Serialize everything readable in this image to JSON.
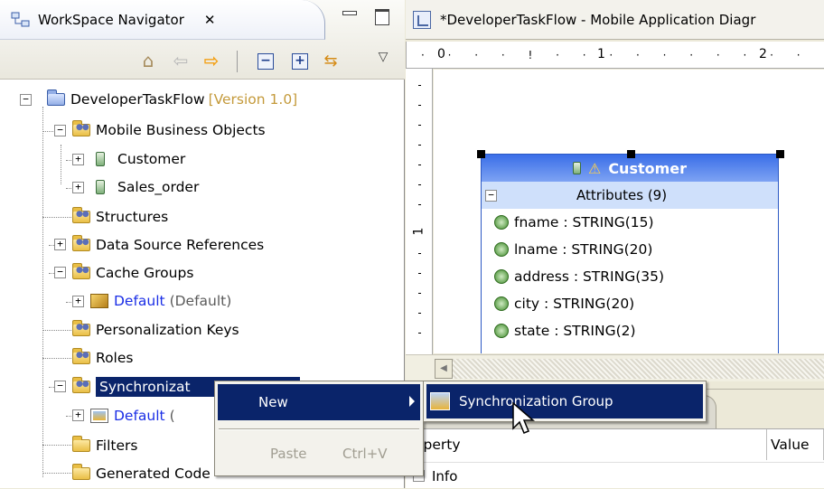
{
  "navigator": {
    "tab_title": "WorkSpace Navigator",
    "close_glyph": "✕"
  },
  "toolbar": {
    "icons": [
      "home-icon",
      "back-arrow-icon",
      "forward-arrow-icon",
      "collapse-all-icon",
      "expand-all-icon",
      "link-with-editor-icon",
      "view-menu-icon"
    ],
    "collapse_glyph": "−",
    "expand_glyph": "+"
  },
  "tree": {
    "project": {
      "label": "DeveloperTaskFlow",
      "version": "[Version 1.0]"
    },
    "items": [
      {
        "label": "Mobile Business Objects"
      },
      {
        "label": "Customer"
      },
      {
        "label": "Sales_order"
      },
      {
        "label": "Structures"
      },
      {
        "label": "Data Source References"
      },
      {
        "label": "Cache Groups"
      },
      {
        "label": "Default",
        "suffix": "(Default)"
      },
      {
        "label": "Personalization Keys"
      },
      {
        "label": "Roles"
      },
      {
        "label": "Synchronizat"
      },
      {
        "label": "Default",
        "suffix": "("
      },
      {
        "label": "Filters"
      },
      {
        "label": "Generated Code"
      }
    ],
    "expander_minus": "−",
    "expander_plus": "+"
  },
  "editor": {
    "tab_title": "*DeveloperTaskFlow - Mobile Application Diagr",
    "ruler_h": [
      "0",
      "1",
      "2"
    ],
    "ruler_v": [
      "1"
    ]
  },
  "mbo": {
    "title": "Customer",
    "section": "Attributes (9)",
    "attributes": [
      "fname : STRING(15)",
      "lname : STRING(20)",
      "address : STRING(35)",
      "city : STRING(20)",
      "state : STRING(2)"
    ]
  },
  "properties": {
    "col_property": "roperty",
    "col_value": "Value",
    "info": "Info"
  },
  "context_menu": {
    "new": "New",
    "paste": "Paste",
    "paste_shortcut": "Ctrl+V"
  },
  "submenu": {
    "item": "Synchronization Group"
  },
  "colors": {
    "selection": "#0a246a",
    "mbo_header": "#3a6ee8",
    "link_blue": "#1a2ee6",
    "version_gold": "#c49a3b"
  }
}
